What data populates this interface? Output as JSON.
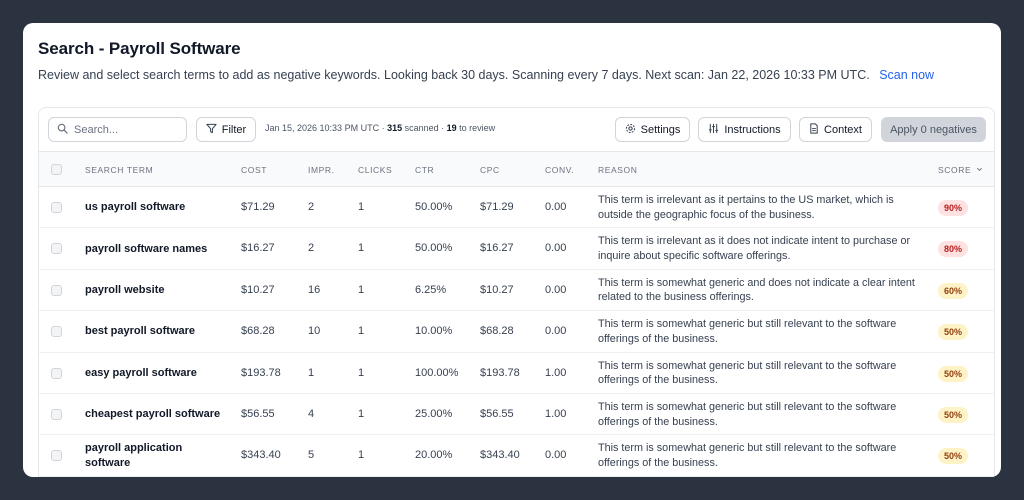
{
  "header": {
    "title": "Search - Payroll Software",
    "subtitle": "Review and select search terms to add as negative keywords. Looking back 30 days. Scanning every 7 days. Next scan: Jan 22, 2026 10:33 PM UTC.",
    "scan_link": "Scan now"
  },
  "toolbar": {
    "search_placeholder": "Search...",
    "filter_label": "Filter",
    "meta_time": "Jan 15, 2026 10:33 PM UTC · ",
    "meta_scanned_count": "315",
    "meta_scanned_label": " scanned · ",
    "meta_review_count": "19",
    "meta_review_label": " to review",
    "settings_label": "Settings",
    "instructions_label": "Instructions",
    "context_label": "Context",
    "apply_label": "Apply 0 negatives"
  },
  "table": {
    "columns": [
      "SEARCH TERM",
      "COST",
      "IMPR.",
      "CLICKS",
      "CTR",
      "CPC",
      "CONV.",
      "REASON",
      "SCORE"
    ],
    "rows": [
      {
        "term": "us payroll software",
        "cost": "$71.29",
        "impr": "2",
        "clicks": "1",
        "ctr": "50.00%",
        "cpc": "$71.29",
        "conv": "0.00",
        "reason": "This term is irrelevant as it pertains to the US market, which is outside the geographic focus of the business.",
        "score": "90%",
        "level": "high"
      },
      {
        "term": "payroll software names",
        "cost": "$16.27",
        "impr": "2",
        "clicks": "1",
        "ctr": "50.00%",
        "cpc": "$16.27",
        "conv": "0.00",
        "reason": "This term is irrelevant as it does not indicate intent to purchase or inquire about specific software offerings.",
        "score": "80%",
        "level": "high"
      },
      {
        "term": "payroll website",
        "cost": "$10.27",
        "impr": "16",
        "clicks": "1",
        "ctr": "6.25%",
        "cpc": "$10.27",
        "conv": "0.00",
        "reason": "This term is somewhat generic and does not indicate a clear intent related to the business offerings.",
        "score": "60%",
        "level": "medium"
      },
      {
        "term": "best payroll software",
        "cost": "$68.28",
        "impr": "10",
        "clicks": "1",
        "ctr": "10.00%",
        "cpc": "$68.28",
        "conv": "0.00",
        "reason": "This term is somewhat generic but still relevant to the software offerings of the business.",
        "score": "50%",
        "level": "medium"
      },
      {
        "term": "easy payroll software",
        "cost": "$193.78",
        "impr": "1",
        "clicks": "1",
        "ctr": "100.00%",
        "cpc": "$193.78",
        "conv": "1.00",
        "reason": "This term is somewhat generic but still relevant to the software offerings of the business.",
        "score": "50%",
        "level": "medium"
      },
      {
        "term": "cheapest payroll software",
        "cost": "$56.55",
        "impr": "4",
        "clicks": "1",
        "ctr": "25.00%",
        "cpc": "$56.55",
        "conv": "1.00",
        "reason": "This term is somewhat generic but still relevant to the software offerings of the business.",
        "score": "50%",
        "level": "medium"
      },
      {
        "term": "payroll application software",
        "cost": "$343.40",
        "impr": "5",
        "clicks": "1",
        "ctr": "20.00%",
        "cpc": "$343.40",
        "conv": "0.00",
        "reason": "This term is somewhat generic but still relevant to the software offerings of the business.",
        "score": "50%",
        "level": "medium"
      }
    ]
  },
  "colors": {
    "background": "#2b3240",
    "link": "#2563eb",
    "badge_high_bg": "#fee2e2",
    "badge_high_text": "#b91c1c",
    "badge_medium_bg": "#fef3c7",
    "badge_medium_text": "#92400e"
  },
  "icons": {
    "search": "search-icon",
    "filter": "filter-icon",
    "settings": "gear-icon",
    "instructions": "sliders-icon",
    "context": "document-icon",
    "sort": "chevron-down-icon"
  }
}
